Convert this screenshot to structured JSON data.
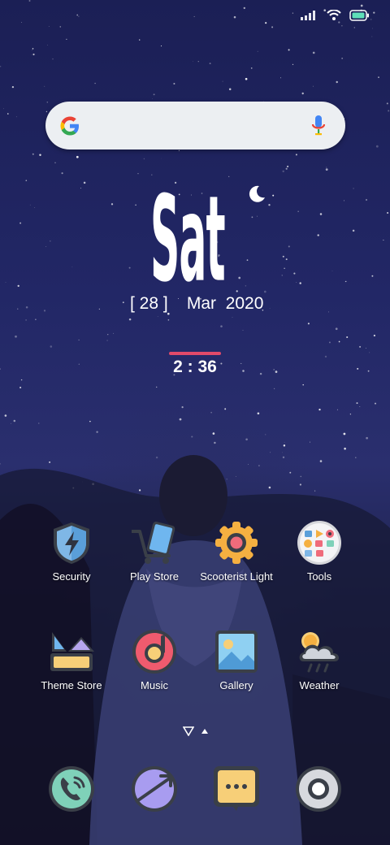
{
  "status_bar": {
    "icons": [
      "signal-icon",
      "wifi-icon",
      "battery-icon"
    ]
  },
  "search_widget": {
    "logo": "google-g-icon",
    "mic": "mic-icon"
  },
  "clock_widget": {
    "day": "Sat",
    "date_day": "[ 28 ]",
    "month_year": "Mar  2020",
    "time": "2 : 36",
    "accent_color": "#e24a6a"
  },
  "apps": [
    {
      "label": "Security",
      "icon": "shield-bolt-icon"
    },
    {
      "label": "Play Store",
      "icon": "shopping-cart-icon"
    },
    {
      "label": "Scooterist Light",
      "icon": "gear-icon"
    },
    {
      "label": "Tools",
      "icon": "tools-folder-icon"
    },
    {
      "label": "Theme Store",
      "icon": "theme-store-icon"
    },
    {
      "label": "Music",
      "icon": "music-disc-icon"
    },
    {
      "label": "Gallery",
      "icon": "gallery-image-icon"
    },
    {
      "label": "Weather",
      "icon": "weather-cloud-icon"
    }
  ],
  "page_indicator": [
    "nav-down-triangle-icon",
    "nav-up-triangle-icon"
  ],
  "dock": [
    {
      "icon": "phone-icon"
    },
    {
      "icon": "browser-compass-icon"
    },
    {
      "icon": "messages-icon"
    },
    {
      "icon": "camera-icon"
    }
  ]
}
